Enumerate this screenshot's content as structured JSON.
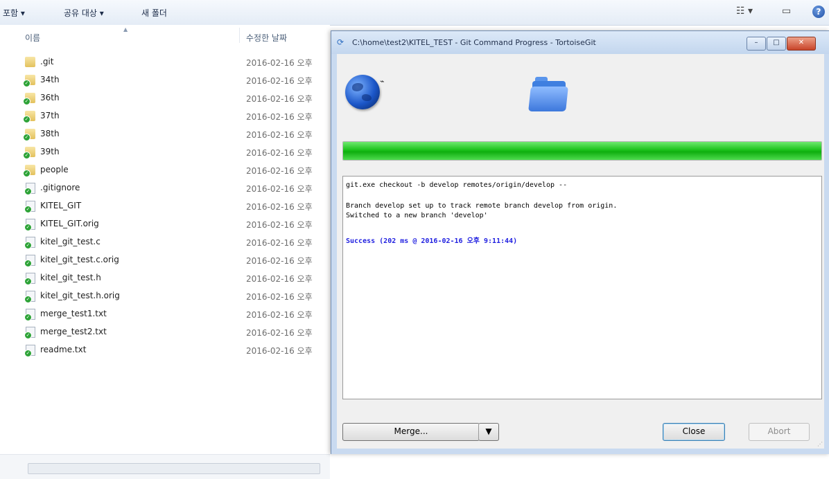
{
  "explorer": {
    "toolbar": {
      "include_label": "포함 ▾",
      "share_label": "공유 대상 ▾",
      "new_folder_label": "새 폴더",
      "view_icon": "view-options-icon",
      "pane_icon": "preview-pane-icon",
      "help_icon": "help-icon"
    },
    "columns": {
      "name": "이름",
      "modified": "수정한 날짜"
    },
    "files": [
      {
        "name": ".git",
        "date": "2016-02-16 오후",
        "kind": "folder",
        "badge": false
      },
      {
        "name": "34th",
        "date": "2016-02-16 오후",
        "kind": "folder",
        "badge": true
      },
      {
        "name": "36th",
        "date": "2016-02-16 오후",
        "kind": "folder",
        "badge": true
      },
      {
        "name": "37th",
        "date": "2016-02-16 오후",
        "kind": "folder",
        "badge": true
      },
      {
        "name": "38th",
        "date": "2016-02-16 오후",
        "kind": "folder",
        "badge": true
      },
      {
        "name": "39th",
        "date": "2016-02-16 오후",
        "kind": "folder",
        "badge": true
      },
      {
        "name": "people",
        "date": "2016-02-16 오후",
        "kind": "folder",
        "badge": true
      },
      {
        "name": ".gitignore",
        "date": "2016-02-16 오후",
        "kind": "file",
        "badge": true
      },
      {
        "name": "KITEL_GIT",
        "date": "2016-02-16 오후",
        "kind": "file",
        "badge": true
      },
      {
        "name": "KITEL_GIT.orig",
        "date": "2016-02-16 오후",
        "kind": "file",
        "badge": true
      },
      {
        "name": "kitel_git_test.c",
        "date": "2016-02-16 오후",
        "kind": "file",
        "badge": true
      },
      {
        "name": "kitel_git_test.c.orig",
        "date": "2016-02-16 오후",
        "kind": "file",
        "badge": true
      },
      {
        "name": "kitel_git_test.h",
        "date": "2016-02-16 오후",
        "kind": "file",
        "badge": true
      },
      {
        "name": "kitel_git_test.h.orig",
        "date": "2016-02-16 오후",
        "kind": "file",
        "badge": true
      },
      {
        "name": "merge_test1.txt",
        "date": "2016-02-16 오후",
        "kind": "file",
        "badge": true
      },
      {
        "name": "merge_test2.txt",
        "date": "2016-02-16 오후",
        "kind": "file",
        "badge": true
      },
      {
        "name": "readme.txt",
        "date": "2016-02-16 오후",
        "kind": "file",
        "badge": true
      }
    ]
  },
  "dialog": {
    "title": "C:\\home\\test2\\KITEL_TEST - Git Command Progress - TortoiseGit",
    "progress_percent": 100,
    "progress_color": "#1bc21b",
    "log": {
      "command": "git.exe checkout -b develop remotes/origin/develop --",
      "line1": "Branch develop set up to track remote branch develop from origin.",
      "line2": "Switched to a new branch 'develop'",
      "success": "Success (202 ms @ 2016-02-16 오후 9:11:44)"
    },
    "buttons": {
      "merge": "Merge...",
      "merge_arrow": "▼",
      "close": "Close",
      "abort": "Abort"
    },
    "caption_buttons": {
      "minimize": "–",
      "maximize": "□",
      "close": "✕"
    }
  }
}
